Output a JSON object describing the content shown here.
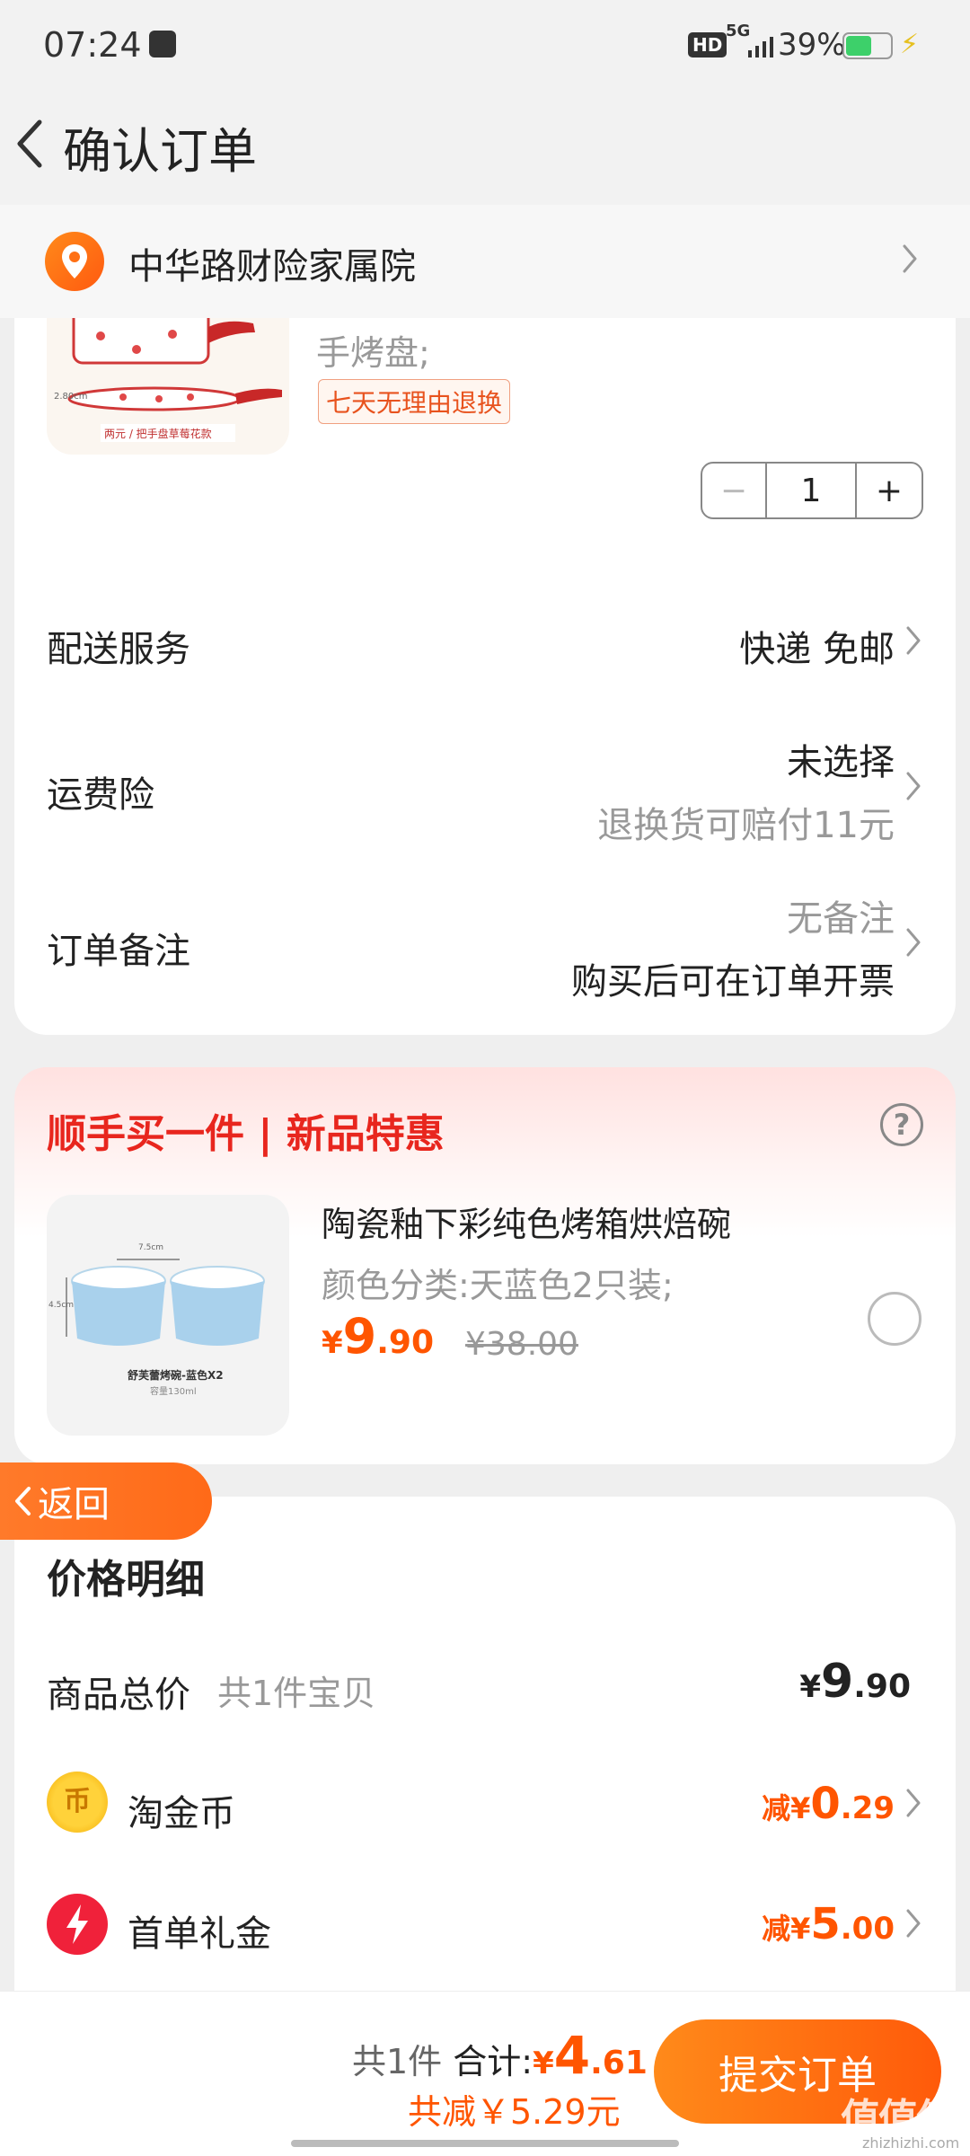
{
  "status_bar": {
    "time": "07:24",
    "hd": "HD",
    "network": "5G",
    "battery": "39%"
  },
  "header": {
    "title": "确认订单"
  },
  "address": {
    "text": "中华路财险家属院"
  },
  "product": {
    "desc": "手烤盘;",
    "thumb_caption": "两元 / 把手盘草莓花款",
    "thumb_dim": "2.80cm",
    "return_tag": "七天无理由退换",
    "quantity": "1",
    "minus": "−",
    "plus": "+"
  },
  "rows": {
    "delivery": {
      "label": "配送服务",
      "value": "快递 免邮"
    },
    "insurance": {
      "label": "运费险",
      "value": "未选择",
      "sub": "退换货可赔付11元"
    },
    "remark": {
      "label": "订单备注",
      "value": "无备注",
      "sub": "购买后可在订单开票"
    }
  },
  "bonus": {
    "title": "顺手买一件 | 新品特惠",
    "help": "?",
    "item": {
      "name": "陶瓷釉下彩纯色烤箱烘焙碗",
      "spec": "颜色分类:天蓝色2只装;",
      "currency": "¥",
      "price_int": "9",
      "price_dec": ".90",
      "old_price": "¥38.00",
      "thumb_caption": "舒芙蕾烤碗-蓝色X2",
      "thumb_sub": "容量130ml",
      "thumb_dim_w": "7.5cm",
      "thumb_dim_h": "4.5cm"
    }
  },
  "return_button": {
    "label": "返回"
  },
  "price_detail": {
    "title": "价格明细",
    "goods": {
      "label": "商品总价",
      "count": "共1件宝贝",
      "currency": "¥",
      "int": "9",
      "dec": ".90"
    },
    "coin": {
      "icon_text": "币",
      "label": "淘金币",
      "prefix": "减",
      "currency": "¥",
      "int": "0",
      "dec": ".29"
    },
    "gift": {
      "label": "首单礼金",
      "prefix": "减",
      "currency": "¥",
      "int": "5",
      "dec": ".00"
    }
  },
  "bottom": {
    "count": "共1件",
    "total_label": "合计:",
    "currency": "¥",
    "total_int": "4",
    "total_dec": ".61",
    "saved": "共减￥5.29元",
    "submit": "提交订单",
    "watermark": "值值值",
    "watermark_sub": "zhizhizhi.com"
  },
  "colors": {
    "accent": "#ff5500",
    "bonus_title": "#e8261e",
    "submit_start": "#ff8a1a",
    "submit_end": "#ff5a0a"
  }
}
